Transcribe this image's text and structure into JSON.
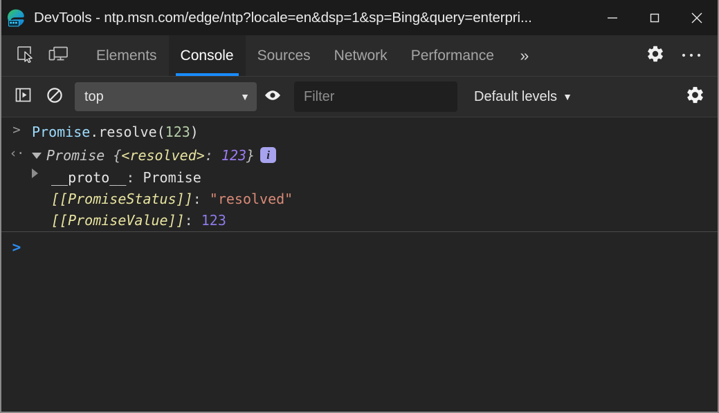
{
  "window": {
    "title": "DevTools - ntp.msn.com/edge/ntp?locale=en&dsp=1&sp=Bing&query=enterpri...",
    "app_icon": "edge-devtools-icon",
    "controls": {
      "minimize": "minimize-icon",
      "maximize": "maximize-icon",
      "close": "close-icon"
    }
  },
  "tabstrip": {
    "inspect_icon": "inspect-element-icon",
    "device_icon": "device-toolbar-icon",
    "tabs": [
      {
        "label": "Elements",
        "active": false
      },
      {
        "label": "Console",
        "active": true
      },
      {
        "label": "Sources",
        "active": false
      },
      {
        "label": "Network",
        "active": false
      },
      {
        "label": "Performance",
        "active": false
      }
    ],
    "more_tabs": "»",
    "settings_icon": "gear-icon",
    "more_icon": "more-options-icon"
  },
  "console_toolbar": {
    "sidebar_toggle_icon": "console-sidebar-icon",
    "clear_icon": "clear-console-icon",
    "context": {
      "label": "top",
      "caret": "▼"
    },
    "live_expression_icon": "eye-icon",
    "filter": {
      "value": "",
      "placeholder": "Filter"
    },
    "levels": {
      "label": "Default levels",
      "caret": "▼"
    },
    "settings_icon": "console-settings-gear-icon"
  },
  "console": {
    "messages": [
      {
        "kind": "input",
        "gutter": ">",
        "tokens": [
          {
            "text": "Promise",
            "style": "t-prop"
          },
          {
            "text": ".resolve",
            "style": "t-plain"
          },
          {
            "text": "(",
            "style": "t-plain"
          },
          {
            "text": "123",
            "style": "t-num"
          },
          {
            "text": ")",
            "style": "t-plain"
          }
        ]
      },
      {
        "kind": "result",
        "gutter": "‹·",
        "expanded": true,
        "tokens": [
          {
            "text": "Promise",
            "style": "t-obj"
          },
          {
            "text": " {",
            "style": "t-brace"
          },
          {
            "text": "<resolved>",
            "style": "t-internal"
          },
          {
            "text": ": ",
            "style": "t-brace"
          },
          {
            "text": "123",
            "style": "t-numval"
          },
          {
            "text": "}",
            "style": "t-brace"
          }
        ],
        "badge": "i",
        "properties": [
          {
            "expandable": true,
            "expanded": false,
            "tokens": [
              {
                "text": "__proto__",
                "style": "t-key"
              },
              {
                "text": ": ",
                "style": "t-colon"
              },
              {
                "text": "Promise",
                "style": "t-plain"
              }
            ]
          },
          {
            "expandable": false,
            "tokens": [
              {
                "text": "[[PromiseStatus]]",
                "style": "t-internal"
              },
              {
                "text": ": ",
                "style": "t-colon"
              },
              {
                "text": "\"resolved\"",
                "style": "t-string"
              }
            ]
          },
          {
            "expandable": false,
            "tokens": [
              {
                "text": "[[PromiseValue]]",
                "style": "t-internal"
              },
              {
                "text": ": ",
                "style": "t-colon"
              },
              {
                "text": "123",
                "style": "t-numval2"
              }
            ]
          }
        ]
      }
    ],
    "prompt": {
      "caret": ">",
      "value": ""
    }
  },
  "colors": {
    "accent_blue": "#1a8cff",
    "prompt_blue": "#2d8cf0",
    "titlebar_bg": "#1b1b1b",
    "toolbar_bg": "#2b2b2b",
    "console_bg": "#242424",
    "badge_purple": "#a7a3ee"
  }
}
